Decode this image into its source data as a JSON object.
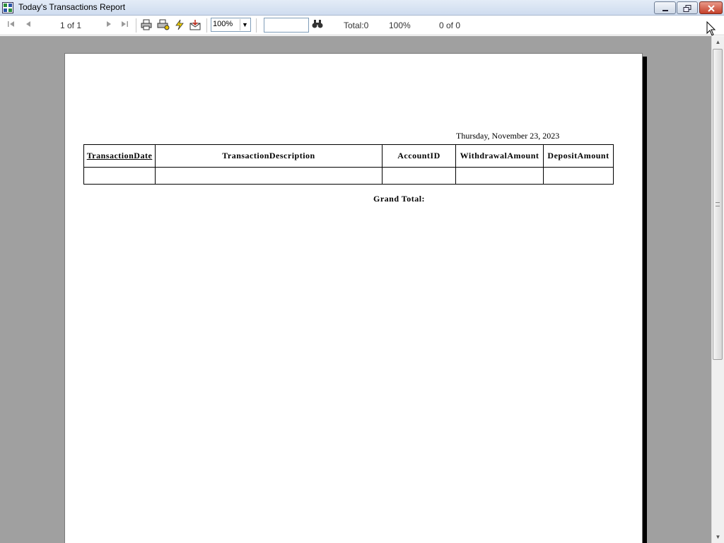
{
  "window": {
    "title": "Today's Transactions Report",
    "minimize_icon": "minimize-icon",
    "restore_icon": "restore-icon",
    "close_icon": "close-icon"
  },
  "toolbar": {
    "page_indicator": "1 of 1",
    "zoom_value": "100%",
    "search_value": "",
    "total_label": "Total:0",
    "percent_label": "100%",
    "match_label": "0 of 0",
    "icons": [
      "first-page-icon",
      "prev-page-icon",
      "next-page-icon",
      "last-page-icon",
      "print-icon",
      "print-setup-icon",
      "refresh-icon",
      "export-icon",
      "find-icon"
    ]
  },
  "report": {
    "date": "Thursday, November 23, 2023",
    "columns": [
      "TransactionDate",
      "TransactionDescription",
      "AccountID",
      "WithdrawalAmount",
      "DepositAmount"
    ],
    "rows": [
      [
        "",
        "",
        "",
        "",
        ""
      ]
    ],
    "grand_total_label": "Grand Total:"
  },
  "colors": {
    "titlebar": "#cfdcef",
    "viewer_background": "#a0a0a0",
    "close_button": "#c4402a"
  }
}
